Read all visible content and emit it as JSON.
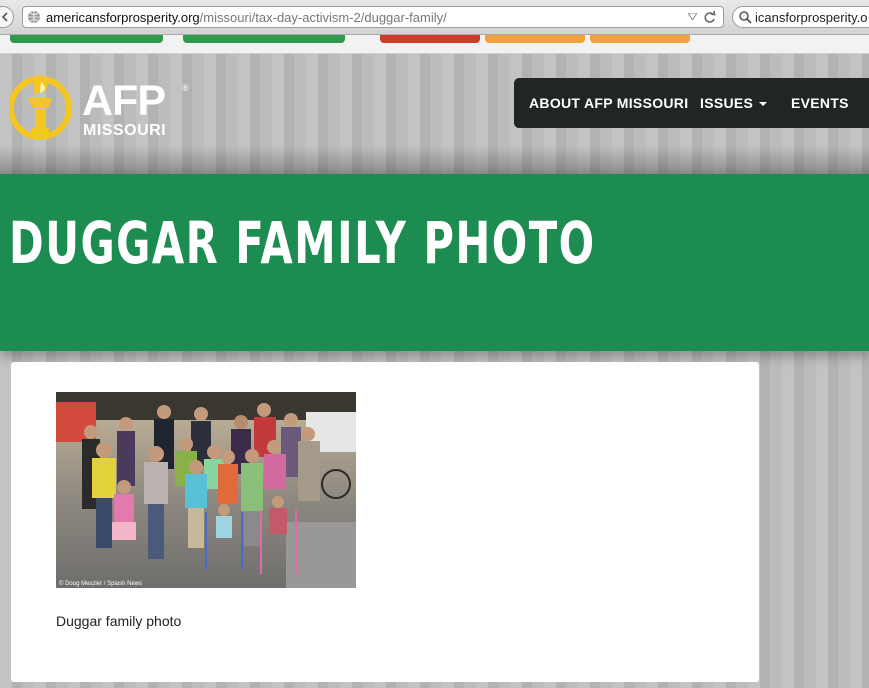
{
  "browser": {
    "url_host": "americansforprosperity.org",
    "url_path": "/missouri/tax-day-activism-2/duggar-family/",
    "search_text": "icansforprosperity.o"
  },
  "tabs_strip": {
    "chip_colors": [
      "#2f9a4e",
      "#2f9a4e",
      "#cf3a2a",
      "#f2a23a",
      "#f2a23a"
    ]
  },
  "logo": {
    "brand": "AFP",
    "reg": "®",
    "region": "MISSOURI",
    "icon": "torch-icon",
    "color": "#f3c623"
  },
  "nav": {
    "items": [
      {
        "label": "ABOUT AFP MISSOURI",
        "has_dropdown": false
      },
      {
        "label": "ISSUES",
        "has_dropdown": true
      },
      {
        "label": "EVENTS",
        "has_dropdown": false
      }
    ]
  },
  "page": {
    "title": "DUGGAR FAMILY PHOTO",
    "band_color": "#1c8c50"
  },
  "content": {
    "photo_credit": "© Doug Meszler / Splash News",
    "caption": "Duggar family photo"
  }
}
